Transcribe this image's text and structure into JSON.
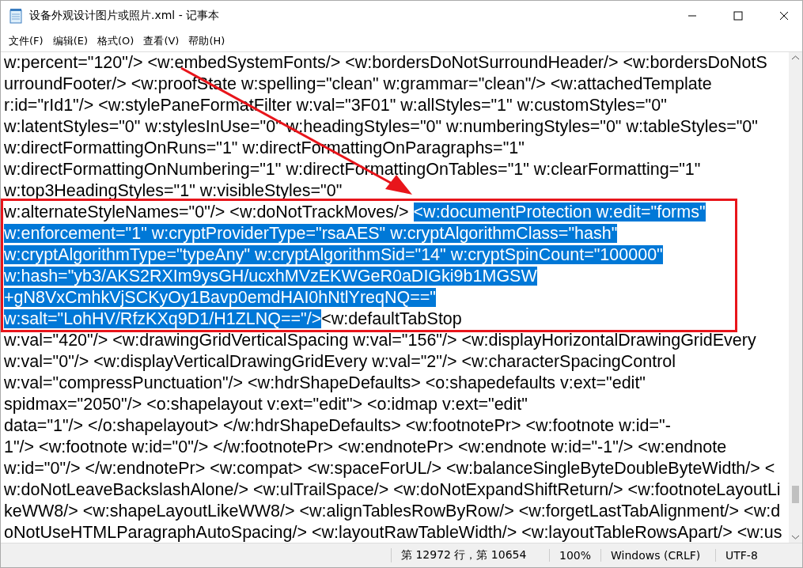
{
  "window": {
    "title": "设备外观设计图片或照片.xml - 记事本"
  },
  "menu": [
    "文件(F)",
    "编辑(E)",
    "格式(O)",
    "查看(V)",
    "帮助(H)"
  ],
  "lines": [
    {
      "segments": [
        {
          "text": "w:percent=\"120\"/> <w:embedSystemFonts/> <w:bordersDoNotSurroundHeader/> <w:bordersDoNotS",
          "selected": false
        }
      ]
    },
    {
      "segments": [
        {
          "text": "urroundFooter/> <w:proofState w:spelling=\"clean\" w:grammar=\"clean\"/> <w:attachedTemplate",
          "selected": false
        }
      ]
    },
    {
      "segments": [
        {
          "text": "r:id=\"rId1\"/> <w:stylePaneFormatFilter w:val=\"3F01\" w:allStyles=\"1\" w:customStyles=\"0\"",
          "selected": false
        }
      ]
    },
    {
      "segments": [
        {
          "text": "w:latentStyles=\"0\" w:stylesInUse=\"0\" w:headingStyles=\"0\" w:numberingStyles=\"0\" w:tableStyles=\"0\"",
          "selected": false
        }
      ]
    },
    {
      "segments": [
        {
          "text": "w:directFormattingOnRuns=\"1\" w:directFormattingOnParagraphs=\"1\"",
          "selected": false
        }
      ]
    },
    {
      "segments": [
        {
          "text": "w:directFormattingOnNumbering=\"1\" w:directFormattingOnTables=\"1\" w:clearFormatting=\"1\"",
          "selected": false
        }
      ]
    },
    {
      "segments": [
        {
          "text": "w:top3HeadingStyles=\"1\" w:visibleStyles=\"0\"",
          "selected": false
        }
      ]
    },
    {
      "segments": [
        {
          "text": "w:alternateStyleNames=\"0\"/> <w:doNotTrackMoves/> ",
          "selected": false
        },
        {
          "text": "<w:documentProtection w:edit=\"forms\"",
          "selected": true
        }
      ]
    },
    {
      "segments": [
        {
          "text": "w:enforcement=\"1\" w:cryptProviderType=\"rsaAES\" w:cryptAlgorithmClass=\"hash\"",
          "selected": true
        }
      ]
    },
    {
      "segments": [
        {
          "text": "w:cryptAlgorithmType=\"typeAny\" w:cryptAlgorithmSid=\"14\" w:cryptSpinCount=\"100000\"",
          "selected": true
        }
      ]
    },
    {
      "segments": [
        {
          "text": "w:hash=\"yb3/AKS2RXIm9ysGH/ucxhMVzEKWGeR0aDIGki9b1MGSW",
          "selected": true
        }
      ]
    },
    {
      "segments": [
        {
          "text": "+gN8VxCmhkVjSCKyOy1Bavp0emdHAI0hNtlYreqNQ==\"",
          "selected": true
        }
      ]
    },
    {
      "segments": [
        {
          "text": "w:salt=\"LohHV/RfzKXq9D1/H1ZLNQ==\"/>",
          "selected": true
        },
        {
          "text": "<w:defaultTabStop",
          "selected": false
        }
      ]
    },
    {
      "segments": [
        {
          "text": "w:val=\"420\"/> <w:drawingGridVerticalSpacing w:val=\"156\"/> <w:displayHorizontalDrawingGridEvery",
          "selected": false
        }
      ]
    },
    {
      "segments": [
        {
          "text": "w:val=\"0\"/> <w:displayVerticalDrawingGridEvery w:val=\"2\"/> <w:characterSpacingControl",
          "selected": false
        }
      ]
    },
    {
      "segments": [
        {
          "text": "w:val=\"compressPunctuation\"/> <w:hdrShapeDefaults> <o:shapedefaults v:ext=\"edit\"",
          "selected": false
        }
      ]
    },
    {
      "segments": [
        {
          "text": "spidmax=\"2050\"/> <o:shapelayout v:ext=\"edit\"> <o:idmap v:ext=\"edit\"",
          "selected": false
        }
      ]
    },
    {
      "segments": [
        {
          "text": "data=\"1\"/> </o:shapelayout> </w:hdrShapeDefaults> <w:footnotePr> <w:footnote w:id=\"-",
          "selected": false
        }
      ]
    },
    {
      "segments": [
        {
          "text": "1\"/> <w:footnote w:id=\"0\"/> </w:footnotePr> <w:endnotePr> <w:endnote w:id=\"-1\"/> <w:endnote",
          "selected": false
        }
      ]
    },
    {
      "segments": [
        {
          "text": "w:id=\"0\"/> </w:endnotePr> <w:compat> <w:spaceForUL/> <w:balanceSingleByteDoubleByteWidth/> <",
          "selected": false
        }
      ]
    },
    {
      "segments": [
        {
          "text": "w:doNotLeaveBackslashAlone/> <w:ulTrailSpace/> <w:doNotExpandShiftReturn/> <w:footnoteLayoutLi",
          "selected": false
        }
      ]
    },
    {
      "segments": [
        {
          "text": "keWW8/> <w:shapeLayoutLikeWW8/> <w:alignTablesRowByRow/> <w:forgetLastTabAlignment/> <w:d",
          "selected": false
        }
      ]
    },
    {
      "segments": [
        {
          "text": "oNotUseHTMLParagraphAutoSpacing/> <w:layoutRawTableWidth/> <w:layoutTableRowsApart/> <w:us",
          "selected": false
        }
      ]
    }
  ],
  "status_bar": [
    "第 12972 行，第 10654",
    "100%",
    "Windows (CRLF)",
    "UTF-8"
  ]
}
